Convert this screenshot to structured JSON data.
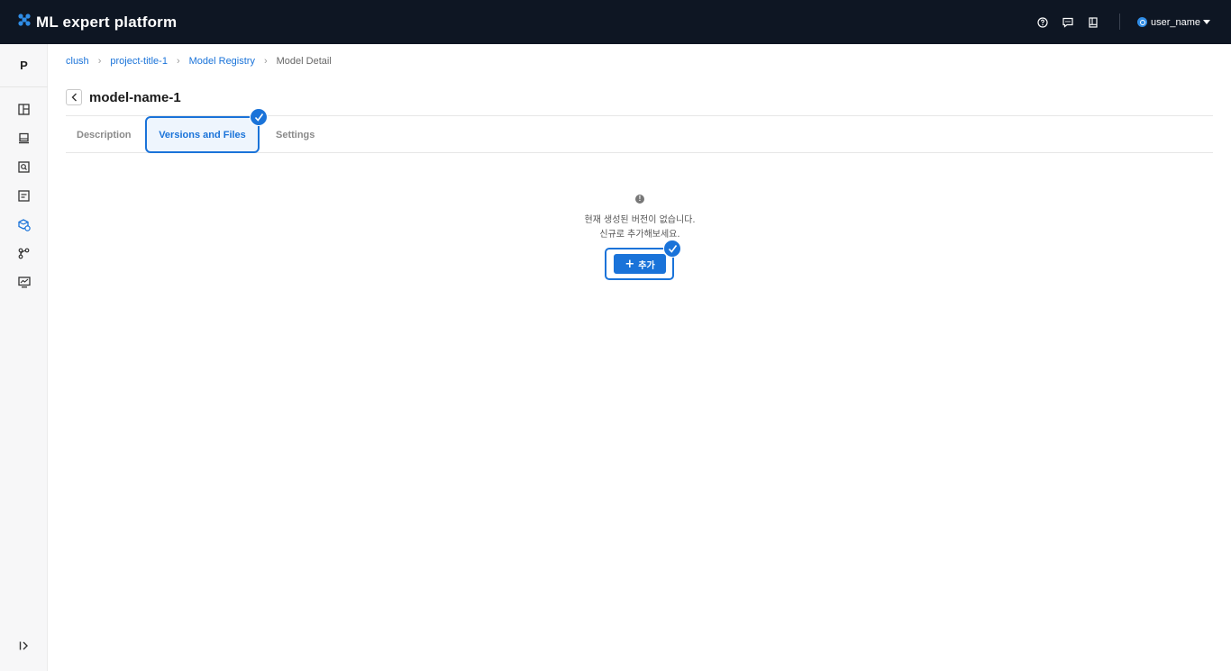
{
  "app": {
    "title": "ML expert platform",
    "accent": "#1a73d9",
    "topbar_bg": "#0e1623"
  },
  "header": {
    "icons": [
      "help-icon",
      "chat-icon",
      "book-icon"
    ],
    "user": {
      "name": "user_name",
      "avatar_color": "#2f8ce5"
    }
  },
  "sidebar": {
    "project_initial": "P",
    "items": [
      {
        "icon": "dashboard-icon"
      },
      {
        "icon": "dataset-icon"
      },
      {
        "icon": "search-box-icon"
      },
      {
        "icon": "report-icon"
      },
      {
        "icon": "model-registry-icon",
        "active": true
      },
      {
        "icon": "pipeline-icon"
      },
      {
        "icon": "monitor-icon"
      }
    ],
    "collapse_icon": "expand-sidebar-icon"
  },
  "breadcrumb": [
    {
      "label": "clush",
      "link": true
    },
    {
      "label": "project-title-1",
      "link": true
    },
    {
      "label": "Model Registry",
      "link": true
    },
    {
      "label": "Model Detail",
      "link": false
    }
  ],
  "page": {
    "title": "model-name-1"
  },
  "tabs": [
    {
      "label": "Description",
      "active": false
    },
    {
      "label": "Versions and Files",
      "active": true
    },
    {
      "label": "Settings",
      "active": false
    }
  ],
  "empty_state": {
    "icon": "!",
    "line1": "현재 생성된 버전이 없습니다.",
    "line2": "신규로 추가해보세요."
  },
  "add_button": {
    "icon": "+",
    "label": "추가"
  }
}
